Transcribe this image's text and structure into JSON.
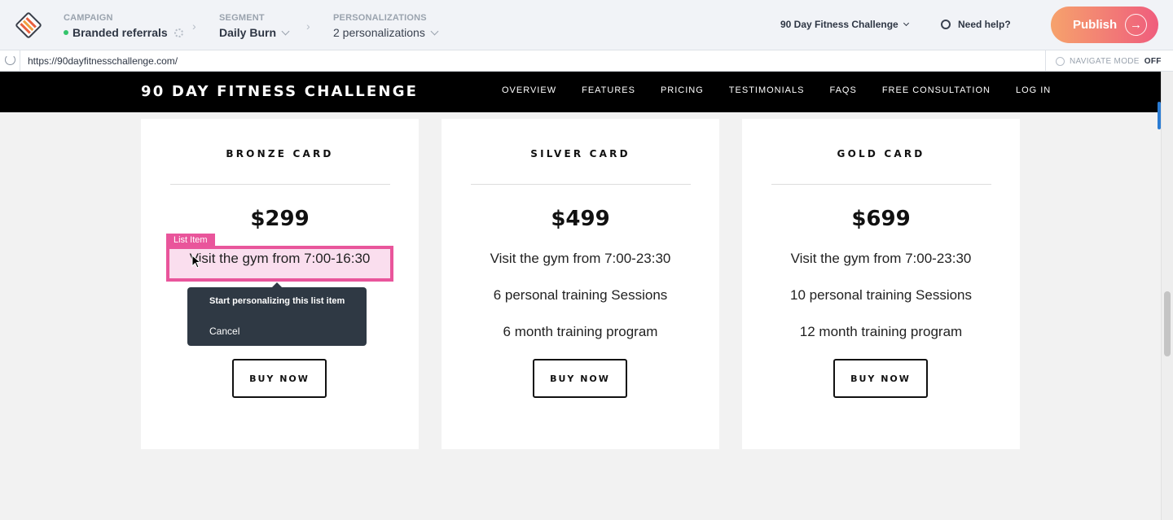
{
  "header": {
    "campaign_label": "CAMPAIGN",
    "campaign_value": "Branded referrals",
    "segment_label": "SEGMENT",
    "segment_value": "Daily Burn",
    "personalizations_label": "PERSONALIZATIONS",
    "personalizations_value": "2 personalizations",
    "site_selector": "90 Day Fitness Challenge",
    "help": "Need help?",
    "publish": "Publish"
  },
  "urlbar": {
    "url": "https://90dayfitnesschallenge.com/",
    "navigate_mode_label": "NAVIGATE MODE",
    "navigate_mode_state": "OFF"
  },
  "site": {
    "brand": "90 DAY FITNESS CHALLENGE",
    "menu": [
      "OVERVIEW",
      "FEATURES",
      "PRICING",
      "TESTIMONIALS",
      "FAQS",
      "FREE CONSULTATION",
      "LOG IN"
    ],
    "cards": [
      {
        "title": "BRONZE CARD",
        "price": "$299",
        "features": [
          "Visit the gym from 7:00-16:30"
        ],
        "button": "BUY NOW"
      },
      {
        "title": "SILVER CARD",
        "price": "$499",
        "features": [
          "Visit the gym from 7:00-23:30",
          "6 personal training Sessions",
          "6 month training program"
        ],
        "button": "BUY NOW"
      },
      {
        "title": "GOLD CARD",
        "price": "$699",
        "features": [
          "Visit the gym from 7:00-23:30",
          "10 personal training Sessions",
          "12 month training program"
        ],
        "button": "BUY NOW"
      }
    ]
  },
  "editor": {
    "selection_tag": "List Item",
    "popover_option_1": "Start personalizing this list item",
    "popover_option_2": "Cancel"
  },
  "colors": {
    "accent_pink": "#e9559b",
    "publish_gradient_start": "#f6a26c",
    "publish_gradient_end": "#ef5d7d",
    "status_green": "#33c46b"
  }
}
